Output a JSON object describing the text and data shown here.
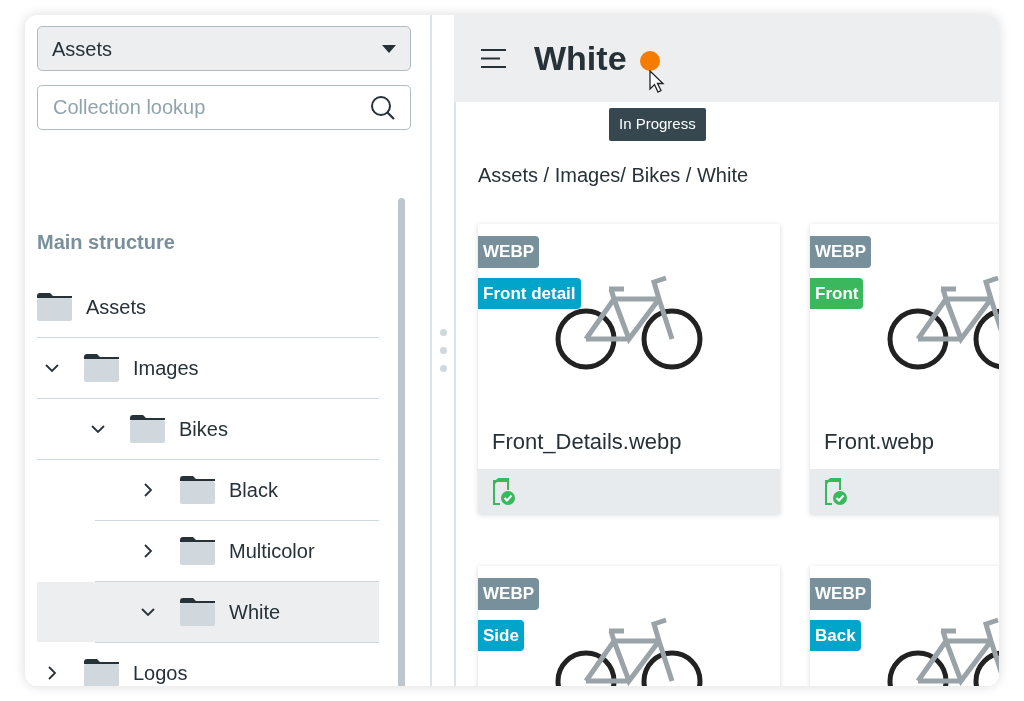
{
  "source_select": {
    "value": "Assets"
  },
  "search": {
    "placeholder": "Collection lookup"
  },
  "tree": {
    "heading": "Main structure",
    "items": [
      {
        "label": "Assets",
        "selected": false
      },
      {
        "label": "Images",
        "expanded": true,
        "selected": false,
        "children": [
          {
            "label": "Bikes",
            "expanded": true,
            "selected": false,
            "children": [
              {
                "label": "Black",
                "expanded": false,
                "selected": false
              },
              {
                "label": "Multicolor",
                "expanded": false,
                "selected": false
              },
              {
                "label": "White",
                "expanded": true,
                "selected": true
              }
            ]
          }
        ]
      },
      {
        "label": "Logos",
        "expanded": false,
        "selected": false
      }
    ]
  },
  "header": {
    "title": "White",
    "tooltip": "In Progress"
  },
  "breadcrumb": "Assets / Images/ Bikes / White",
  "assets": [
    {
      "format": "WEBP",
      "tag": {
        "label": "Front detail",
        "color": "#00a5c9"
      },
      "name": "Front_Details.webp"
    },
    {
      "format": "WEBP",
      "tag": {
        "label": "Front",
        "color": "#3bb75e"
      },
      "name": "Front.webp"
    },
    {
      "format": "WEBP",
      "tag": {
        "label": "Side",
        "color": "#00a5c9"
      }
    },
    {
      "format": "WEBP",
      "tag": {
        "label": "Back",
        "color": "#00a5c9"
      }
    }
  ]
}
